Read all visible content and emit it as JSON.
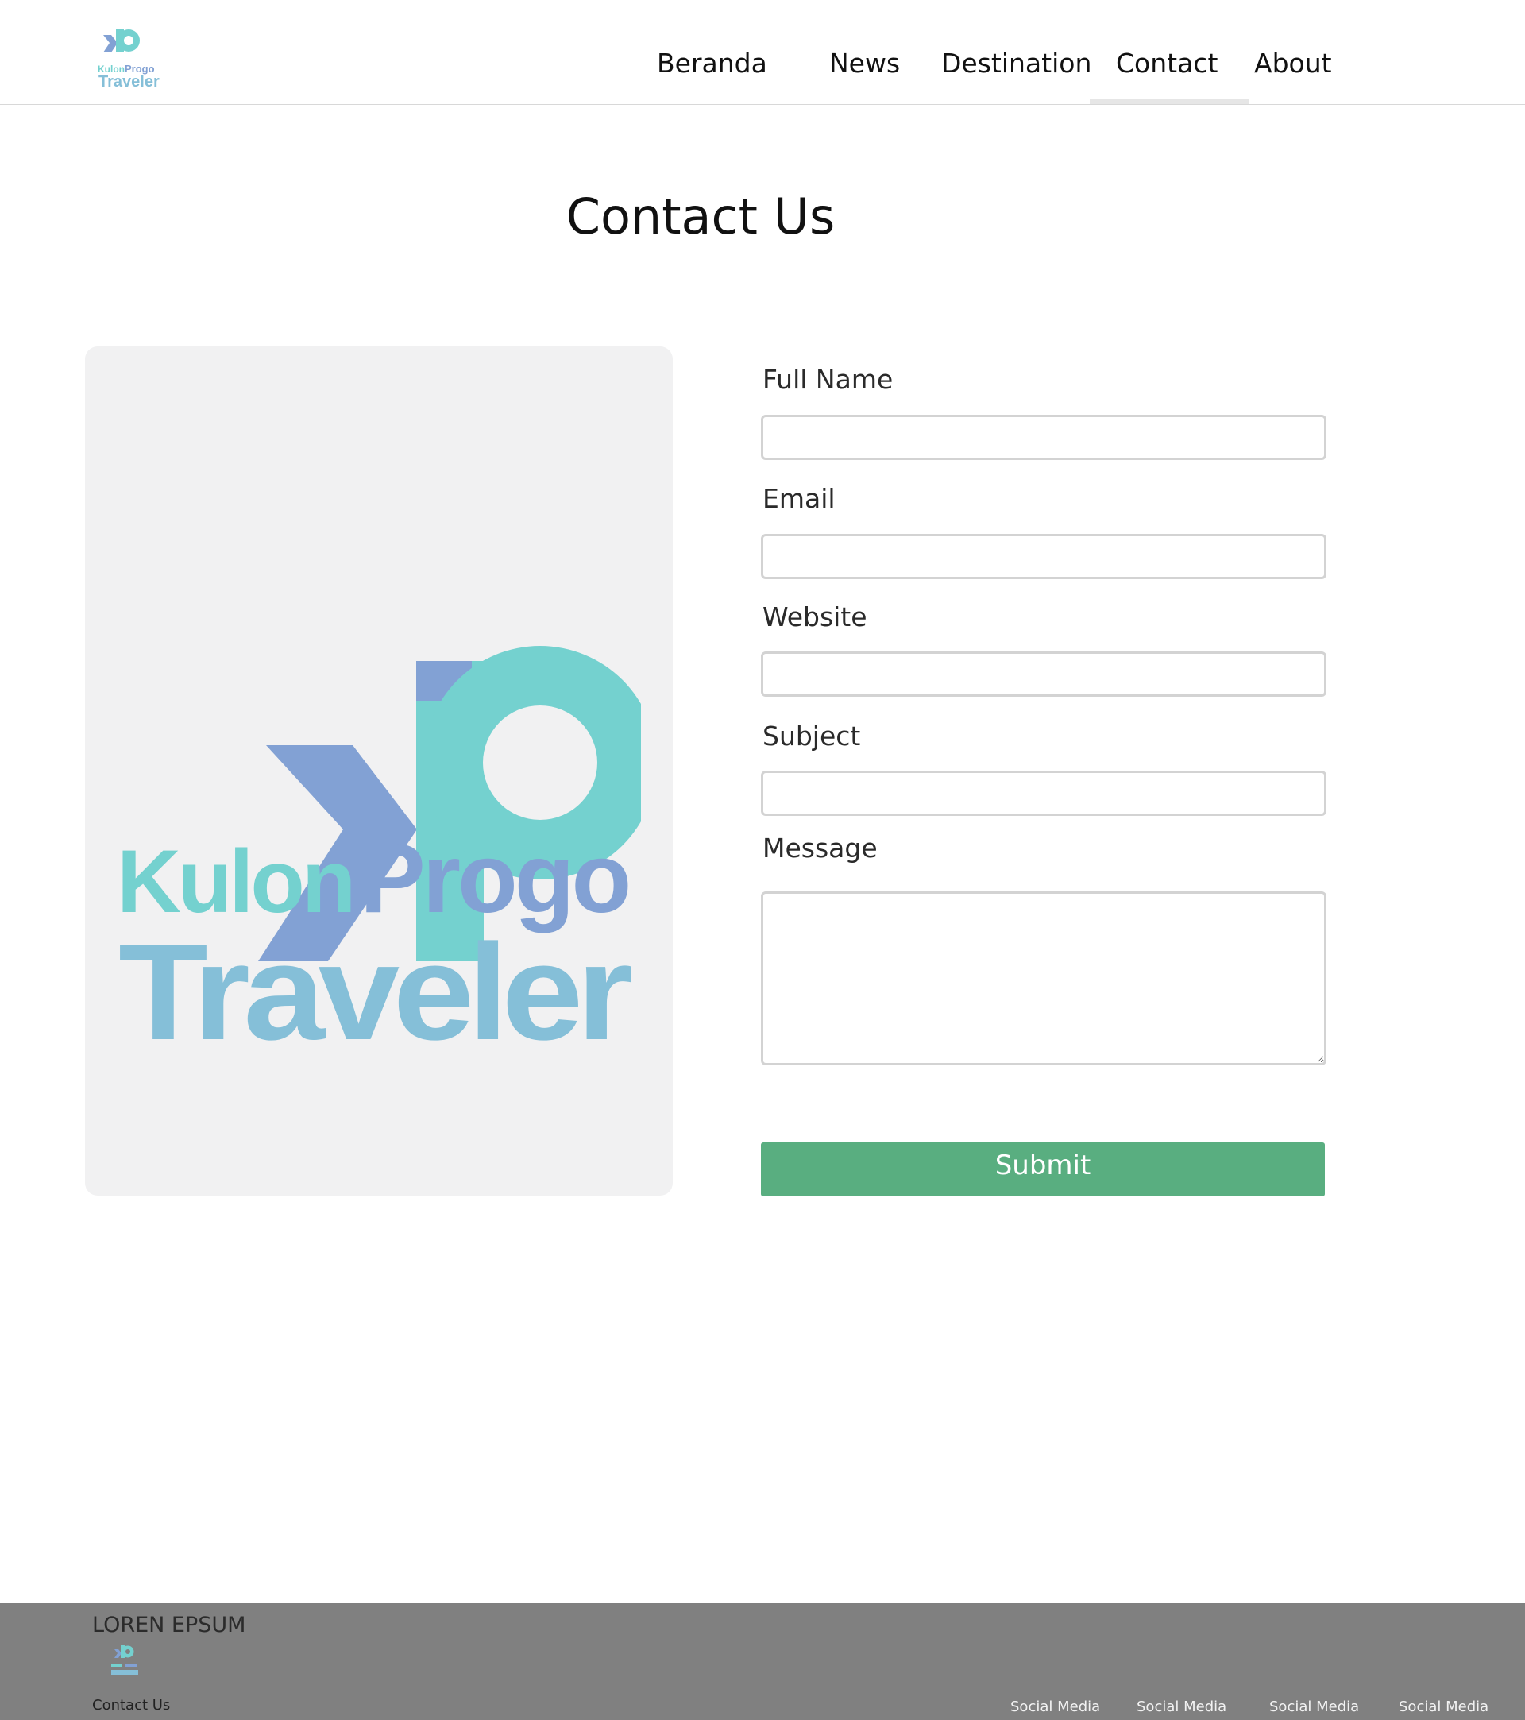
{
  "header": {
    "logo_text_line1_a": "Kulon",
    "logo_text_line1_b": "Progo",
    "logo_text_line2": "Traveler",
    "nav": [
      {
        "label": "Beranda"
      },
      {
        "label": "News"
      },
      {
        "label": "Destination"
      },
      {
        "label": "Contact",
        "active": true
      },
      {
        "label": "About"
      }
    ]
  },
  "page_title": "Contact Us",
  "logo_card": {
    "line1_a": "Kulon",
    "line1_b": "Progo",
    "line2": "Traveler"
  },
  "form": {
    "fields": [
      {
        "label": "Full Name",
        "value": ""
      },
      {
        "label": "Email",
        "value": ""
      },
      {
        "label": "Website",
        "value": ""
      },
      {
        "label": "Subject",
        "value": ""
      },
      {
        "label": "Message",
        "value": ""
      }
    ],
    "submit_label": "Submit"
  },
  "footer": {
    "brand": "LOREN EPSUM",
    "contact_link": "Contact Us",
    "social": [
      "Social Media",
      "Social Media",
      "Social Media",
      "Social Media"
    ]
  },
  "colors": {
    "teal": "#74d1cf",
    "periwinkle": "#82a1d4",
    "sky": "#85bfd8",
    "submit_green": "#59ae80",
    "footer_grey": "#808080"
  },
  "icons": {
    "brand_logo": "kp-monogram-logo"
  }
}
